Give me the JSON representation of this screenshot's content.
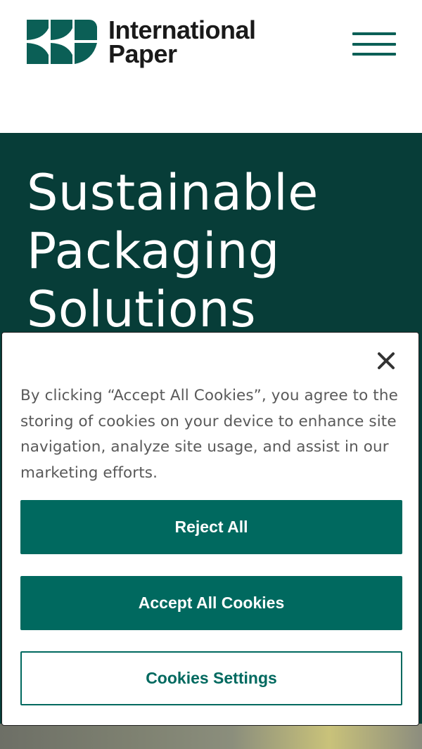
{
  "header": {
    "logo": {
      "line1": "International",
      "line2": "Paper"
    },
    "menu_icon": "hamburger-menu-icon"
  },
  "hero": {
    "title": "Sustainable Packaging Solutions"
  },
  "cookie_banner": {
    "close_icon": "close-icon",
    "text": "By clicking “Accept All Cookies”, you agree to the storing of cookies on your device to enhance site navigation, analyze site usage, and assist in our marketing efforts.",
    "reject_label": "Reject All",
    "accept_label": "Accept All Cookies",
    "settings_label": "Cookies Settings"
  },
  "colors": {
    "brand_green": "#00695f",
    "hero_background": "#073d38",
    "logo_green": "#0b5f56"
  }
}
